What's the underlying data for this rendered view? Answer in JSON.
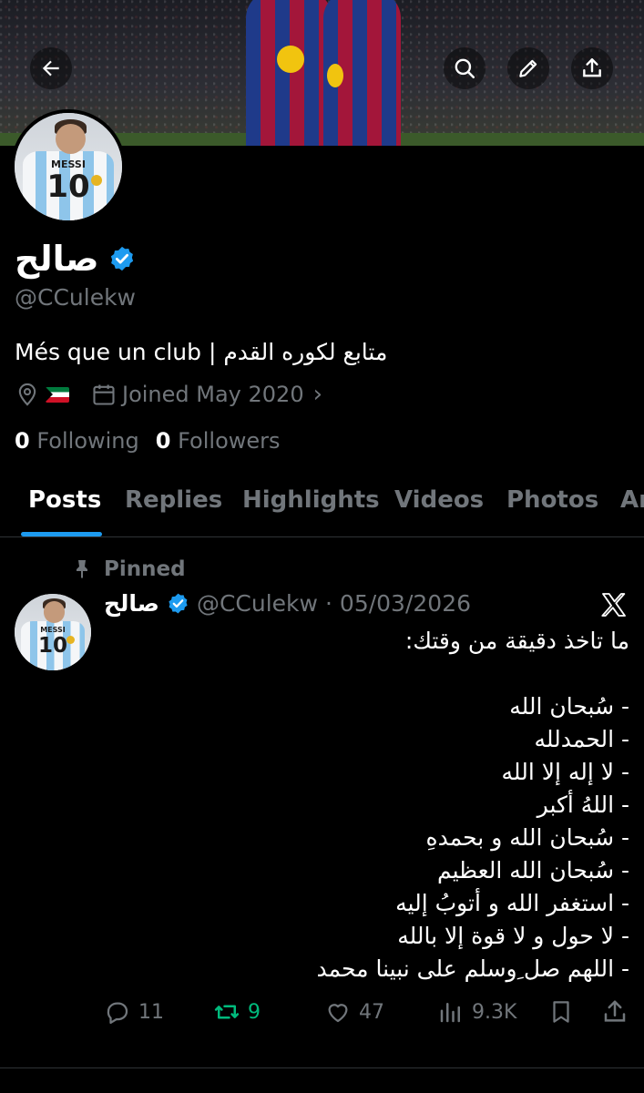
{
  "header": {
    "back_icon": "arrow-left-icon",
    "search_icon": "search-icon",
    "edit_icon": "pencil-icon",
    "share_icon": "share-icon"
  },
  "profile": {
    "display_name": "صالح",
    "handle": "@CCulekw",
    "bio": "Més que un club | متابع لكوره القدم",
    "location_flag": "kuwait-flag",
    "joined": "Joined May 2020",
    "following_count": "0",
    "following_label": "Following",
    "followers_count": "0",
    "followers_label": "Followers",
    "avatar": {
      "shirt_name": "MESSI",
      "shirt_number": "10"
    }
  },
  "tabs": [
    {
      "label": "Posts",
      "active": true
    },
    {
      "label": "Replies",
      "active": false
    },
    {
      "label": "Highlights",
      "active": false
    },
    {
      "label": "Videos",
      "active": false
    },
    {
      "label": "Photos",
      "active": false
    },
    {
      "label": "Ar",
      "active": false
    }
  ],
  "pinned_post": {
    "pinned_label": "Pinned",
    "author_name": "صالح",
    "author_handle": "@CCulekw",
    "separator": "·",
    "date": "05/03/2026",
    "lines": [
      "ما تاخذ دقيقة من وقتك:",
      "",
      "- سُبحان الله",
      "- الحمدلله",
      "- لا إله إلا الله",
      "- اللهُ أكبر",
      "- سُبحان الله و بحمدهِ",
      "- سُبحان الله العظيم",
      "- استغفر الله و أتوبُ إليه",
      "- لا حول و لا قوة إلا بالله",
      "- اللهم صل ِوسلم على نبينا محمد"
    ],
    "replies": "11",
    "reposts": "9",
    "likes": "47",
    "views": "9.3K"
  },
  "colors": {
    "accent": "#1d9bf0",
    "repost_active": "#00ba7c",
    "muted": "#71767b",
    "background": "#000000"
  }
}
